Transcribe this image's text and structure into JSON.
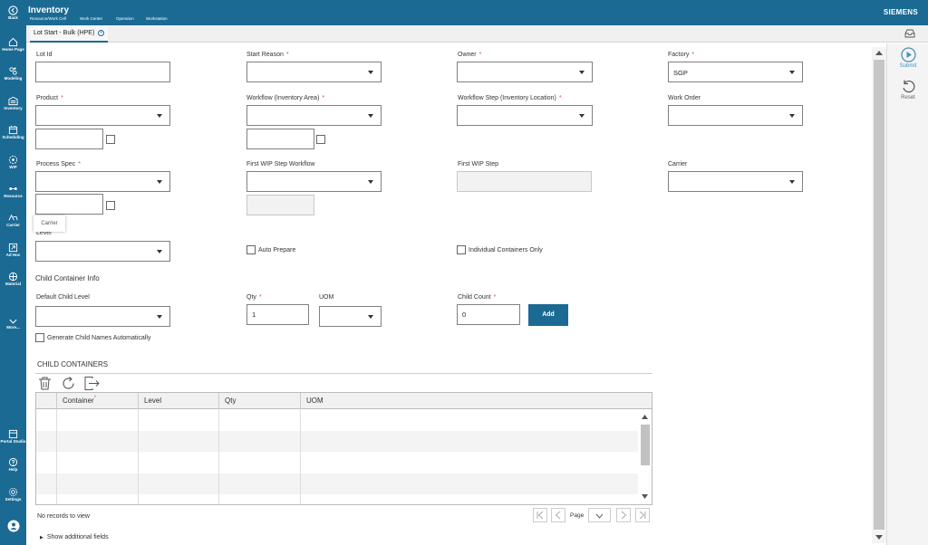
{
  "app": {
    "title": "Inventory",
    "breadcrumb": [
      "Resource/Work Cell",
      "Work Center",
      "Operation",
      "Workstation"
    ],
    "brand": "SIEMENS"
  },
  "sidebar": {
    "back": "Back",
    "items": [
      "Home Page",
      "Modeling",
      "Inventory",
      "Scheduling",
      "WIP",
      "Resource",
      "Carrier",
      "Ad Hoc",
      "Material",
      "More..."
    ],
    "bottom": [
      "Portal Studio",
      "Help",
      "Settings"
    ]
  },
  "tab": {
    "label": "Lot Start - Bulk (HPE)"
  },
  "form": {
    "lot_id": {
      "label": "Lot Id",
      "value": ""
    },
    "start_reason": {
      "label": "Start Reason",
      "value": ""
    },
    "owner": {
      "label": "Owner",
      "value": ""
    },
    "factory": {
      "label": "Factory",
      "value": "SGP"
    },
    "product": {
      "label": "Product",
      "value": ""
    },
    "workflow": {
      "label": "Workflow (Inventory Area)",
      "value": ""
    },
    "workflow_step": {
      "label": "Workflow Step (Inventory Location)",
      "value": ""
    },
    "work_order": {
      "label": "Work Order",
      "value": ""
    },
    "process_spec": {
      "label": "Process Spec",
      "value": ""
    },
    "first_wip_step_workflow": {
      "label": "First WIP Step Workflow",
      "value": ""
    },
    "first_wip_step": {
      "label": "First WIP Step",
      "value": ""
    },
    "carrier": {
      "label": "Carrier",
      "value": ""
    },
    "level": {
      "label": "Level",
      "value": ""
    },
    "auto_prepare": "Auto Prepare",
    "individual_containers_only": "Individual Containers Only"
  },
  "tooltip": "Carrier",
  "child_info": {
    "title": "Child Container Info",
    "default_child_level": {
      "label": "Default Child Level",
      "value": ""
    },
    "qty": {
      "label": "Qty",
      "value": "1"
    },
    "uom": {
      "label": "UOM",
      "value": ""
    },
    "child_count": {
      "label": "Child Count",
      "value": "0"
    },
    "add_button": "Add",
    "generate_names": "Generate Child Names Automatically"
  },
  "grid": {
    "title": "CHILD CONTAINERS",
    "columns": [
      "Container",
      "Level",
      "Qty",
      "UOM"
    ],
    "no_records": "No records to view",
    "page_label": "Page"
  },
  "show_additional": "Show additional fields",
  "actions": {
    "submit": "Submit",
    "reset": "Reset"
  },
  "colors": {
    "brand": "#1a6a94",
    "required": "#d2544b"
  }
}
